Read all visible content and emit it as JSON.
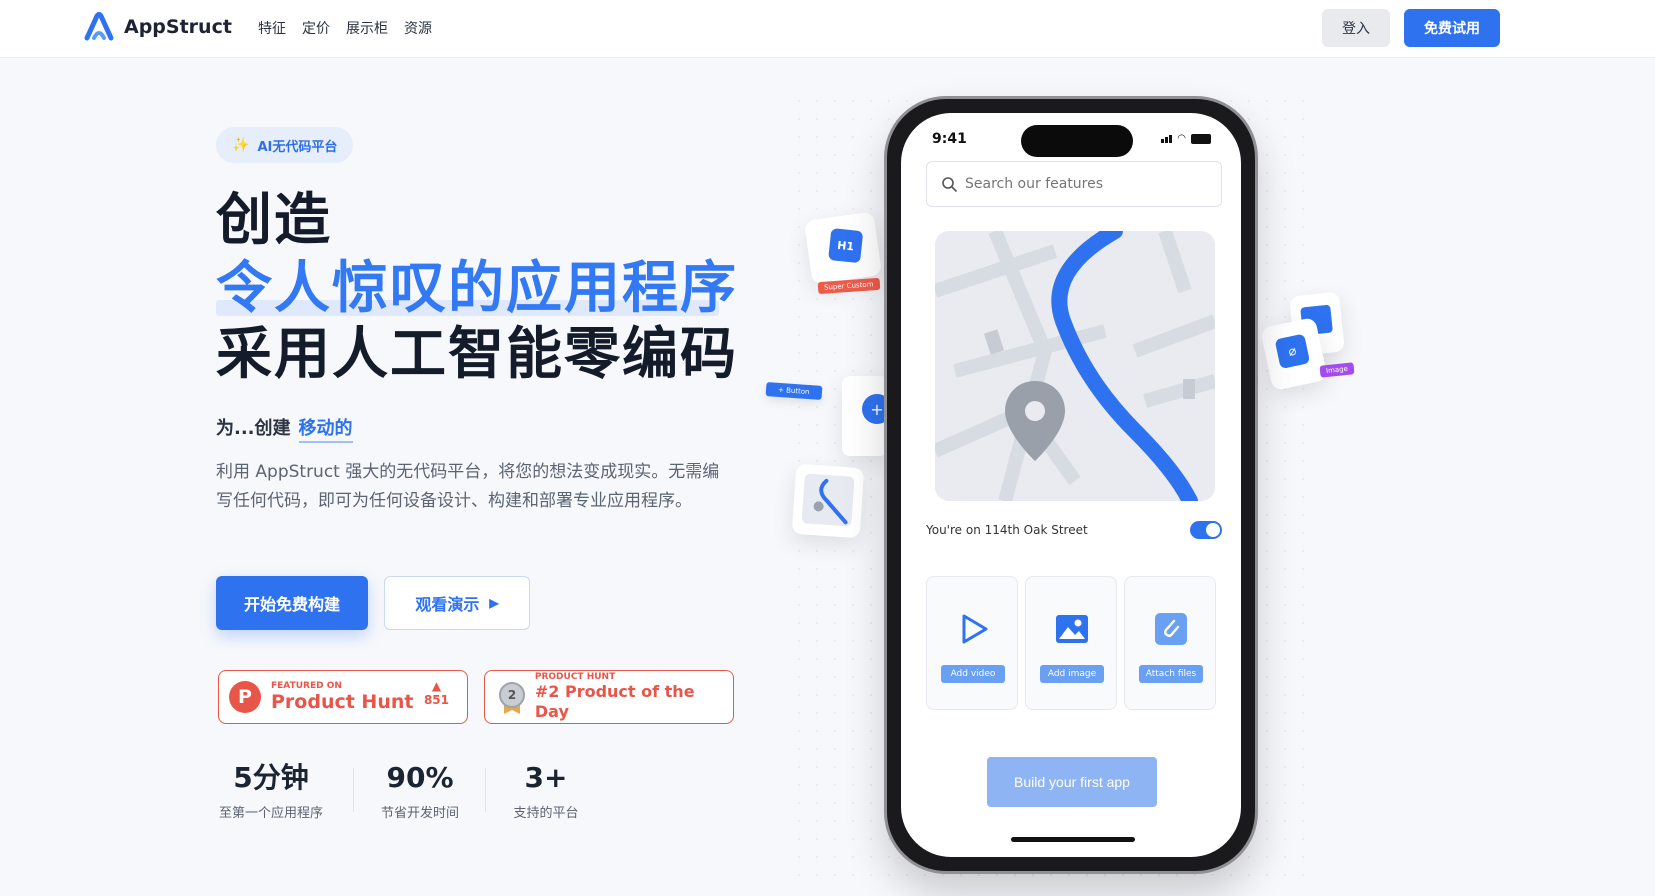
{
  "header": {
    "logo_text": "AppStruct",
    "nav": [
      "特征",
      "定价",
      "展示柜",
      "资源"
    ],
    "login_label": "登入",
    "trial_label": "免费试用"
  },
  "hero": {
    "badge": "AI无代码平台",
    "title_line1": "创造",
    "title_line2": "令人惊叹的应用程序",
    "title_line3": "采用人工智能零编码",
    "sub_prefix": "为...创建",
    "sub_accent": "移动的",
    "description": "利用 AppStruct 强大的无代码平台，将您的想法变成现实。无需编写任何代码，即可为任何设备设计、构建和部署专业应用程序。",
    "start_button": "开始免费构建",
    "demo_button": "观看演示"
  },
  "badges": {
    "ph_small": "FEATURED ON",
    "ph_big": "Product Hunt",
    "ph_count": "851",
    "pod_small": "PRODUCT HUNT",
    "pod_big": "#2 Product of the Day",
    "pod_rank": "2"
  },
  "stats": [
    {
      "value": "5分钟",
      "label": "至第一个应用程序"
    },
    {
      "value": "90%",
      "label": "节省开发时间"
    },
    {
      "value": "3+",
      "label": "支持的平台"
    }
  ],
  "phone": {
    "time": "9:41",
    "search_placeholder": "Search our features",
    "location_text": "You're on 114th Oak Street",
    "tiles": [
      "Add video",
      "Add image",
      "Attach files"
    ],
    "build_button": "Build your first app"
  },
  "floating": {
    "h1_label": "H1",
    "chip_super": "Super Custom",
    "chip_button": "+ Button",
    "chip_image": "Image"
  },
  "colors": {
    "accent": "#2f72f0",
    "producthunt": "#e8564a"
  }
}
